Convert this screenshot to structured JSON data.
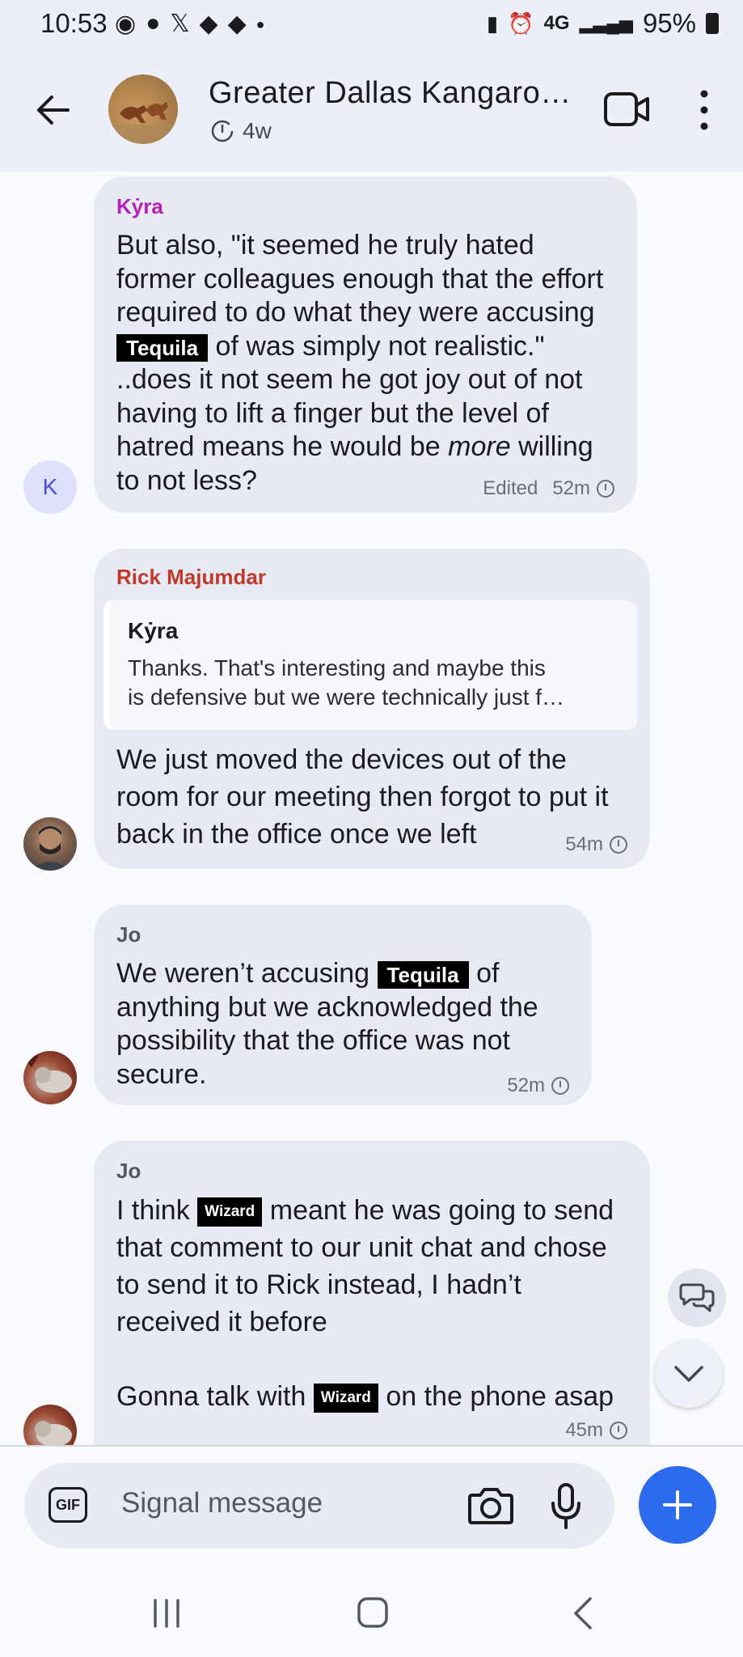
{
  "status_bar": {
    "time": "10:53",
    "network": "4G",
    "battery": "95%",
    "notification_icons": [
      "signal-app-icon",
      "chat-icon",
      "x-icon",
      "game-icon",
      "game-icon",
      "dot-icon"
    ]
  },
  "header": {
    "title": "Greater Dallas Kangaro…",
    "disappearing_timer": "4w"
  },
  "messages": [
    {
      "sender": "Kẏra",
      "sender_color": "#b521b5",
      "avatar_letter": "K",
      "parts": [
        "But also, \"it seemed he truly hated former colleagues enough that the effort required to do what they were accusing ",
        "Tequila",
        " of was simply not realistic.\" ..does it not seem he got joy out of not having to lift a finger but the level of hatred means he would be ",
        "more",
        " willing to not less?"
      ],
      "edited_label": "Edited",
      "time": "52m"
    },
    {
      "sender": "Rick Majumdar",
      "sender_color": "#c0392b",
      "quote": {
        "author": "Kẏra",
        "line1": "Thanks. That's interesting and maybe this",
        "line2": "is defensive but we were technically just f…"
      },
      "text": "We just moved the devices out of the room for our meeting then forgot to put it back in the office once we left",
      "time": "54m"
    },
    {
      "sender": "Jo",
      "sender_color": "#555761",
      "parts": [
        "We weren’t accusing ",
        "Tequila",
        " of anything but we acknowledged the possibility that the office was not secure."
      ],
      "time": "52m"
    },
    {
      "sender": "Jo",
      "sender_color": "#555761",
      "parts": [
        "I think ",
        "Wizard",
        " meant he was going to send that comment to our unit chat and chose to send it to Rick instead, I hadn’t received it before",
        "Gonna talk with ",
        "Wizard",
        " on the phone asap"
      ],
      "time": "45m"
    }
  ],
  "composer": {
    "gif_label": "GIF",
    "placeholder": "Signal message"
  },
  "colors": {
    "accent": "#2c6bed",
    "bubble": "#e7e9f3",
    "header_bg": "#eceff8"
  }
}
